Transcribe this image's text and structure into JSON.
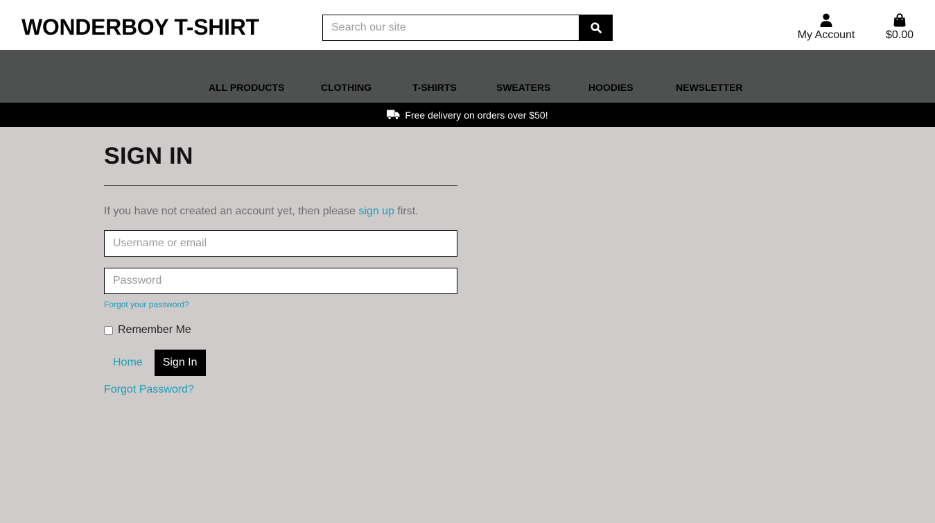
{
  "header": {
    "logo": "WONDERBOY T-SHIRT",
    "search_placeholder": "Search our site",
    "search_value": "",
    "account_label": "My Account",
    "cart_total": "$0.00",
    "icons": {
      "search": "magnifier-icon",
      "account": "user-icon",
      "cart": "shopping-bag-icon"
    }
  },
  "nav": {
    "items": [
      "ALL PRODUCTS",
      "CLOTHING",
      "T-SHIRTS",
      "SWEATERS",
      "HOODIES",
      "NEWSLETTER"
    ]
  },
  "promo": {
    "text": "Free delivery on orders over $50!",
    "icon": "delivery-truck-icon"
  },
  "signin": {
    "title": "SIGN IN",
    "intro_before": "If you have not created an account yet, then please ",
    "intro_link": "sign up",
    "intro_after": " first.",
    "username_placeholder": "Username or email",
    "username_value": "",
    "password_placeholder": "Password",
    "password_value": "",
    "forgot_small": "Forgot your password?",
    "remember_label": "Remember Me",
    "remember_checked": false,
    "home_button": "Home",
    "signin_button": "Sign In",
    "forgot_big": "Forgot Password?"
  },
  "colors": {
    "page_bg": "#cfcbcb",
    "nav_bg": "#4f5050",
    "promo_bg": "#000000",
    "link": "#1a9fb8",
    "button_bg": "#000000"
  }
}
